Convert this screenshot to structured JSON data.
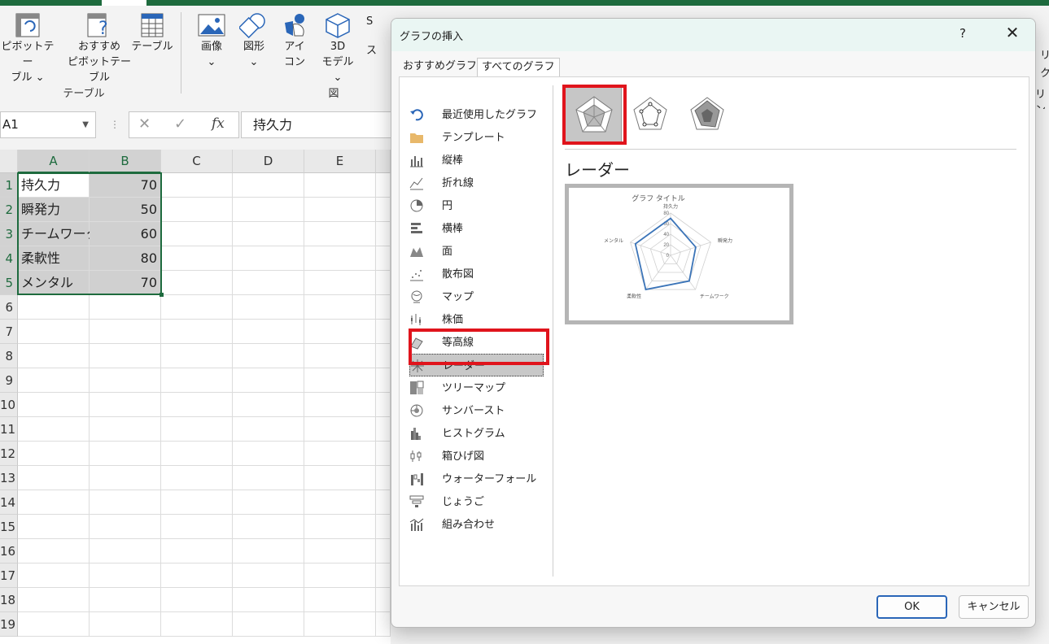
{
  "ribbon": {
    "pivot_table": "ピボットテー\nブル ⌄",
    "pivot_line1": "ピボットテー",
    "pivot_line2": "ブル ⌄",
    "recommended_line1": "おすすめ",
    "recommended_line2": "ピボットテーブル",
    "table": "テーブル",
    "group_table": "テーブル",
    "image": "画像",
    "image_chev": "⌄",
    "shape": "図形",
    "shape_chev": "⌄",
    "icon_line1": "アイ",
    "icon_line2": "コン",
    "model_line1": "3D",
    "model_line2": "モデル ⌄",
    "group_figure": "図",
    "smartart_partial": "S",
    "screenshot_partial": "ス",
    "right_partial1": "リ",
    "right_partial2": "ク",
    "right_partial3": "リン"
  },
  "formula_bar": {
    "name_box": "A1",
    "cancel": "✕",
    "enter": "✓",
    "fx": "fx",
    "value": "持久力"
  },
  "sheet": {
    "columns": [
      "A",
      "B",
      "C",
      "D",
      "E"
    ],
    "rows": [
      "1",
      "2",
      "3",
      "4",
      "5",
      "6",
      "7",
      "8",
      "9",
      "10",
      "11",
      "12",
      "13",
      "14",
      "15",
      "16",
      "17",
      "18",
      "19"
    ],
    "data": [
      {
        "label": "持久力",
        "value": "70"
      },
      {
        "label": "瞬発力",
        "value": "50"
      },
      {
        "label": "チームワーク",
        "value": "60"
      },
      {
        "label": "柔軟性",
        "value": "80"
      },
      {
        "label": "メンタル",
        "value": "70"
      }
    ]
  },
  "dialog": {
    "title": "グラフの挿入",
    "help": "?",
    "close": "✕",
    "tabs": [
      "おすすめグラフ",
      "すべてのグラフ"
    ],
    "categories": [
      {
        "label": "最近使用したグラフ",
        "icon": "undo-icon"
      },
      {
        "label": "テンプレート",
        "icon": "folder-icon"
      },
      {
        "label": "縦棒",
        "icon": "column-chart-icon"
      },
      {
        "label": "折れ線",
        "icon": "line-chart-icon"
      },
      {
        "label": "円",
        "icon": "pie-chart-icon"
      },
      {
        "label": "横棒",
        "icon": "bar-chart-icon"
      },
      {
        "label": "面",
        "icon": "area-chart-icon"
      },
      {
        "label": "散布図",
        "icon": "scatter-chart-icon"
      },
      {
        "label": "マップ",
        "icon": "map-chart-icon"
      },
      {
        "label": "株価",
        "icon": "stock-chart-icon"
      },
      {
        "label": "等高線",
        "icon": "surface-chart-icon"
      },
      {
        "label": "レーダー",
        "icon": "radar-chart-icon"
      },
      {
        "label": "ツリーマップ",
        "icon": "treemap-chart-icon"
      },
      {
        "label": "サンバースト",
        "icon": "sunburst-chart-icon"
      },
      {
        "label": "ヒストグラム",
        "icon": "histogram-chart-icon"
      },
      {
        "label": "箱ひげ図",
        "icon": "boxwhisker-chart-icon"
      },
      {
        "label": "ウォーターフォール",
        "icon": "waterfall-chart-icon"
      },
      {
        "label": "じょうご",
        "icon": "funnel-chart-icon"
      },
      {
        "label": "組み合わせ",
        "icon": "combo-chart-icon"
      }
    ],
    "selected_category": "レーダー",
    "chart_subtype_title": "レーダー",
    "ok": "OK",
    "cancel": "キャンセル",
    "accent": "#e0141c"
  },
  "chart_data": {
    "type": "radar",
    "title": "グラフ タイトル",
    "categories": [
      "持久力",
      "瞬発力",
      "チームワーク",
      "柔軟性",
      "メンタル"
    ],
    "values": [
      70,
      50,
      60,
      80,
      70
    ],
    "ticks": [
      "80",
      "60",
      "40",
      "20",
      "0"
    ],
    "rmax": 80,
    "series_color": "#3b74b8"
  }
}
